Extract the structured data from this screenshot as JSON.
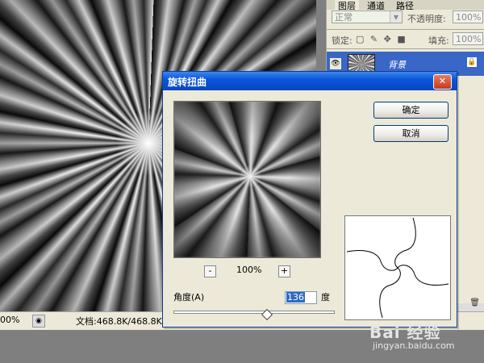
{
  "canvas": {},
  "status_bar": {
    "zoom": "00%",
    "doc_info": "文档:468.8K/468.8K"
  },
  "layers_panel": {
    "tabs": [
      "图层",
      "通道",
      "路径"
    ],
    "blend_mode": "正常",
    "opacity_label": "不透明度:",
    "opacity_value": "100%",
    "lock_label": "锁定:",
    "fill_label": "填充:",
    "fill_value": "100%",
    "layer_name": "背景"
  },
  "dialog": {
    "title": "旋转扭曲",
    "ok_label": "确定",
    "cancel_label": "取消",
    "zoom_out_label": "-",
    "zoom_in_label": "+",
    "zoom_value": "100%",
    "angle_label": "角度(A)",
    "angle_value": "136",
    "degree_label": "度",
    "angle_slider_fraction": 0.58
  },
  "watermark": {
    "logo_text": "Bai 经验",
    "url": "jingyan.baidu.com"
  },
  "colors": {
    "titlebar": "#0a57d9",
    "selection": "#3a67c6",
    "panel": "#ece9d8"
  }
}
